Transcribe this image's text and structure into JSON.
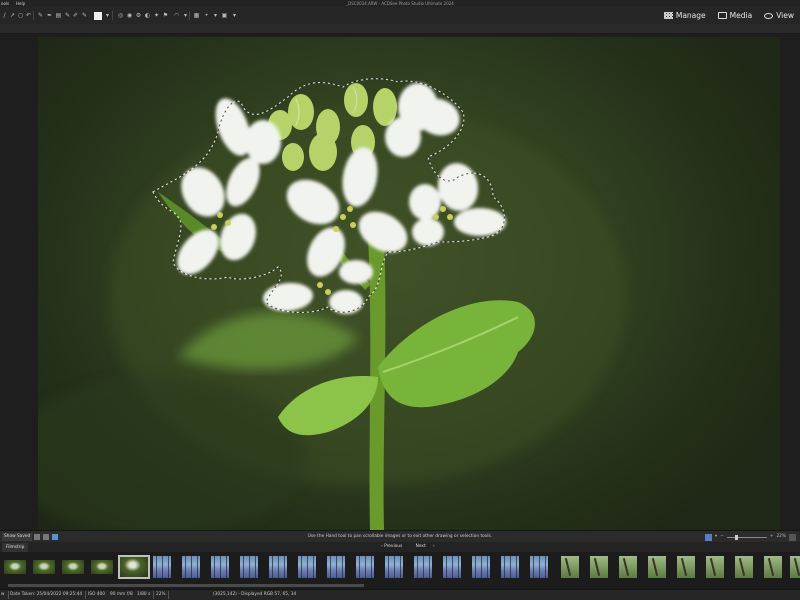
{
  "menu": {
    "items": [
      "ools",
      "Help"
    ],
    "window_title": "_DSC0034.ARW - ACDSee Photo Studio Ultimate 2024"
  },
  "modes": [
    {
      "label": "Manage",
      "icon": "grid-icon"
    },
    {
      "label": "Media",
      "icon": "media-icon"
    },
    {
      "label": "View",
      "icon": "eye-icon"
    }
  ],
  "status": {
    "show_saved": "Show Saved",
    "hint": "Use the Hand tool to pan scrollable images or to exit other drawing or selection tools.",
    "zoom": "22%"
  },
  "filmstrip": {
    "tab": "Filmstrip",
    "previous": "Previous",
    "next": "Next",
    "thumbnails": [
      "flower",
      "flower",
      "flower",
      "flower",
      "selected",
      "forest",
      "forest",
      "forest",
      "forest",
      "forest",
      "forest",
      "forest",
      "forest",
      "forest",
      "forest",
      "forest",
      "forest",
      "forest",
      "forest",
      "green",
      "green",
      "green",
      "green",
      "green",
      "green",
      "green",
      "green",
      "green"
    ]
  },
  "info": {
    "left": "w",
    "date_taken": "Date Taken: 25/04/2022 09:25:44",
    "iso": "ISO 400",
    "focal": "90 mm",
    "aperture": "f/8",
    "shutter": "1/80 s",
    "zoom": "22%",
    "pixel": "(3025,142) - Displayed RGB 57, 65, 34"
  },
  "colors": {
    "accent": "#5b8fd6",
    "background": "#1b1b1b",
    "photo_bg": "#2f3d1f"
  }
}
